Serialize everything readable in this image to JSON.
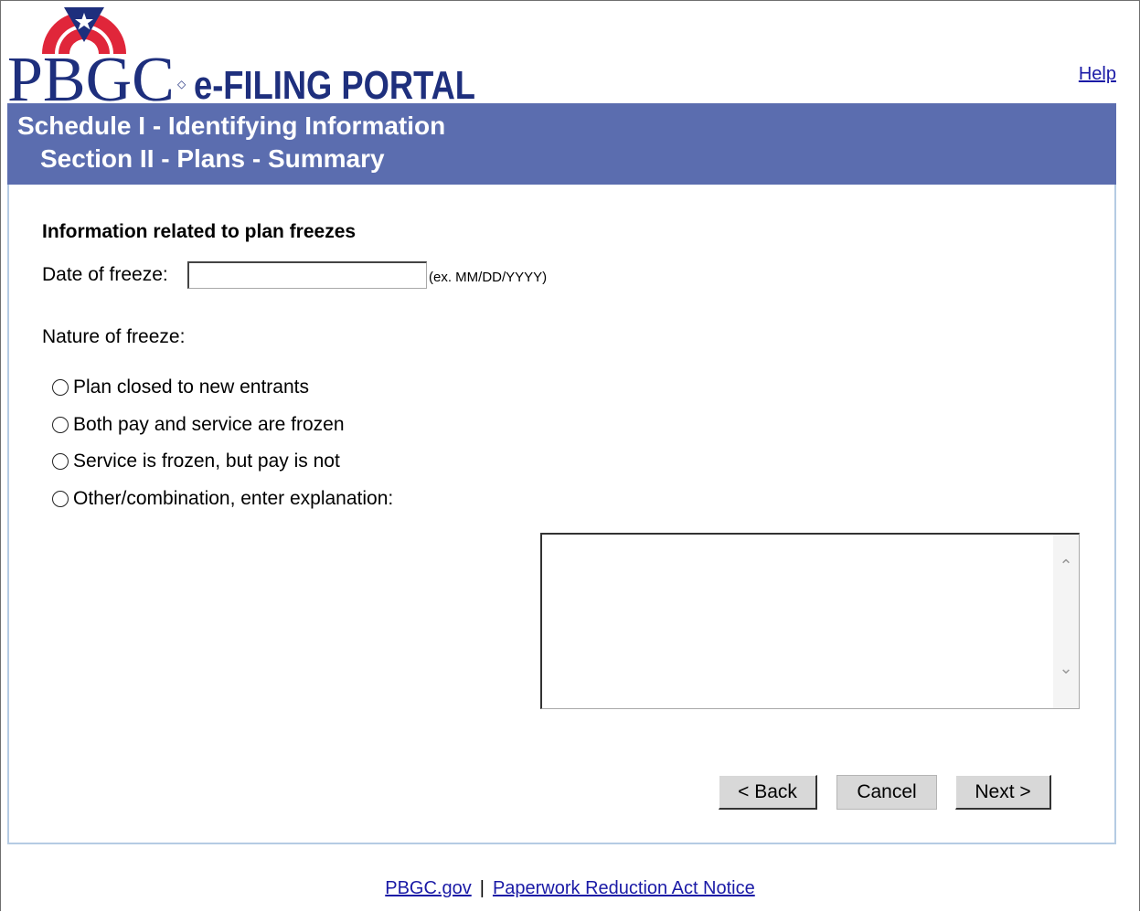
{
  "header": {
    "logo": {
      "brand": "PBGC",
      "portal": "e-FILING PORTAL",
      "colors": {
        "navy": "#1e2f7d",
        "red": "#e0263a",
        "portal_text": "#1e2f7d"
      }
    },
    "help_label": "Help"
  },
  "banner": {
    "title_line1": "Schedule I - Identifying Information",
    "title_line2": "Section II - Plans - Summary",
    "color": "#5b6daf"
  },
  "form": {
    "section_heading": "Information related to plan freezes",
    "date_label": "Date of freeze:",
    "date_value": "",
    "date_hint": "(ex. MM/DD/YYYY)",
    "nature_label": "Nature of freeze:",
    "options": [
      {
        "label": "Plan closed to new entrants",
        "selected": false
      },
      {
        "label": "Both pay and service are frozen",
        "selected": false
      },
      {
        "label": "Service is frozen, but pay is not",
        "selected": false
      },
      {
        "label": "Other/combination, enter explanation:",
        "selected": false
      }
    ],
    "explanation_value": ""
  },
  "buttons": {
    "back": "< Back",
    "cancel": "Cancel",
    "next": "Next >"
  },
  "footer": {
    "link1": "PBGC.gov",
    "separator": "|",
    "link2": "Paperwork Reduction Act Notice"
  }
}
